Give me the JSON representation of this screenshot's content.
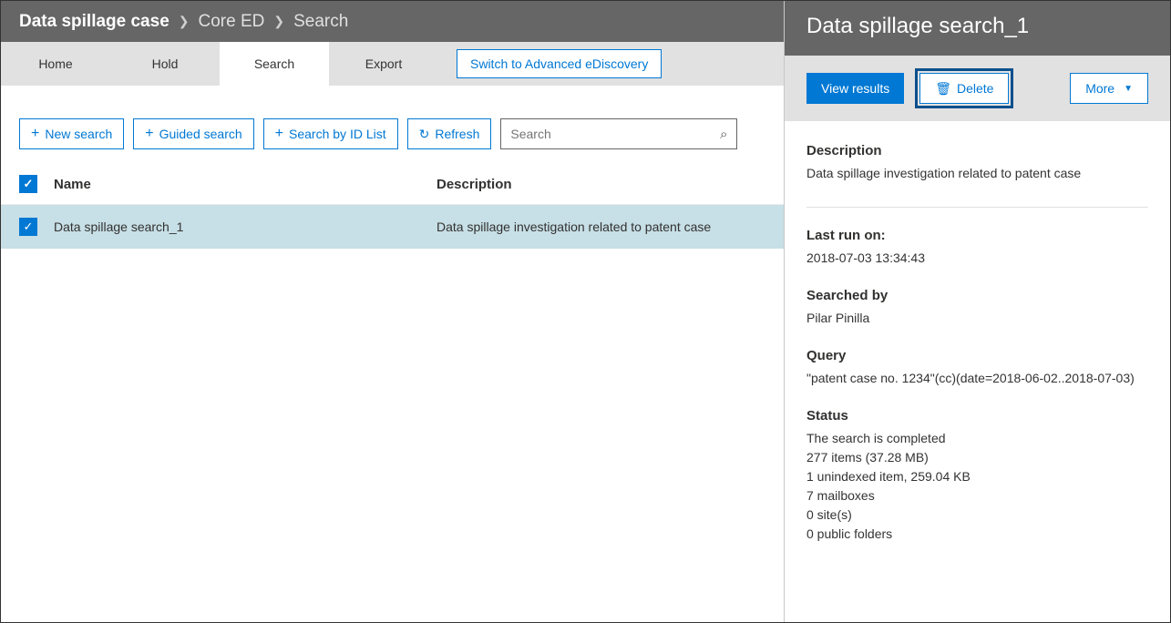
{
  "breadcrumb": {
    "root": "Data spillage case",
    "mid": "Core ED",
    "leaf": "Search"
  },
  "tabs": {
    "home": "Home",
    "hold": "Hold",
    "search": "Search",
    "export": "Export",
    "advanced": "Switch to Advanced eDiscovery"
  },
  "toolbar": {
    "new_search": "New search",
    "guided_search": "Guided search",
    "search_by_id": "Search by ID List",
    "refresh": "Refresh",
    "search_placeholder": "Search"
  },
  "table": {
    "headers": {
      "name": "Name",
      "description": "Description"
    },
    "rows": [
      {
        "name": "Data spillage search_1",
        "description": "Data spillage investigation related to patent case"
      }
    ]
  },
  "detail": {
    "title": "Data spillage search_1",
    "actions": {
      "view_results": "View results",
      "delete": "Delete",
      "more": "More"
    },
    "sections": {
      "description_label": "Description",
      "description": "Data spillage investigation related to patent case",
      "last_run_label": "Last run on:",
      "last_run": "2018-07-03 13:34:43",
      "searched_by_label": "Searched by",
      "searched_by": "Pilar Pinilla",
      "query_label": "Query",
      "query": "\"patent case no. 1234\"(cc)(date=2018-06-02..2018-07-03)",
      "status_label": "Status",
      "status_lines": [
        "The search is completed",
        "277 items (37.28 MB)",
        "1 unindexed item, 259.04 KB",
        "7 mailboxes",
        "0 site(s)",
        "0 public folders"
      ]
    }
  }
}
